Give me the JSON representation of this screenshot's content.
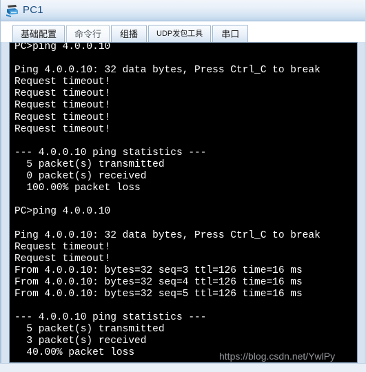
{
  "window": {
    "title": "PC1",
    "icon": "pc-device-icon"
  },
  "tabs": [
    {
      "label": "基础配置",
      "active": false,
      "name": "tab-basic-config"
    },
    {
      "label": "命令行",
      "active": true,
      "name": "tab-command-line"
    },
    {
      "label": "组播",
      "active": false,
      "name": "tab-multicast"
    },
    {
      "label": "UDP发包工具",
      "active": false,
      "name": "tab-udp-tool",
      "small": true
    },
    {
      "label": "串口",
      "active": false,
      "name": "tab-serial-port"
    }
  ],
  "terminal": {
    "lines": [
      "PC>ping 4.0.0.10",
      "",
      "Ping 4.0.0.10: 32 data bytes, Press Ctrl_C to break",
      "Request timeout!",
      "Request timeout!",
      "Request timeout!",
      "Request timeout!",
      "Request timeout!",
      "",
      "--- 4.0.0.10 ping statistics ---",
      "  5 packet(s) transmitted",
      "  0 packet(s) received",
      "  100.00% packet loss",
      "",
      "PC>ping 4.0.0.10",
      "",
      "Ping 4.0.0.10: 32 data bytes, Press Ctrl_C to break",
      "Request timeout!",
      "Request timeout!",
      "From 4.0.0.10: bytes=32 seq=3 ttl=126 time=16 ms",
      "From 4.0.0.10: bytes=32 seq=4 ttl=126 time=16 ms",
      "From 4.0.0.10: bytes=32 seq=5 ttl=126 time=16 ms",
      "",
      "--- 4.0.0.10 ping statistics ---",
      "  5 packet(s) transmitted",
      "  3 packet(s) received",
      "  40.00% packet loss"
    ],
    "text": "PC>ping 4.0.0.10\n\nPing 4.0.0.10: 32 data bytes, Press Ctrl_C to break\nRequest timeout!\nRequest timeout!\nRequest timeout!\nRequest timeout!\nRequest timeout!\n\n--- 4.0.0.10 ping statistics ---\n  5 packet(s) transmitted\n  0 packet(s) received\n  100.00% packet loss\n\nPC>ping 4.0.0.10\n\nPing 4.0.0.10: 32 data bytes, Press Ctrl_C to break\nRequest timeout!\nRequest timeout!\nFrom 4.0.0.10: bytes=32 seq=3 ttl=126 time=16 ms\nFrom 4.0.0.10: bytes=32 seq=4 ttl=126 time=16 ms\nFrom 4.0.0.10: bytes=32 seq=5 ttl=126 time=16 ms\n\n--- 4.0.0.10 ping statistics ---\n  5 packet(s) transmitted\n  3 packet(s) received\n  40.00% packet loss",
    "background_color": "#000000",
    "text_color": "#ffffff",
    "prompt": "PC>",
    "target_host": "4.0.0.10"
  },
  "watermark": {
    "text": "https://blog.csdn.net/YwlPy"
  }
}
